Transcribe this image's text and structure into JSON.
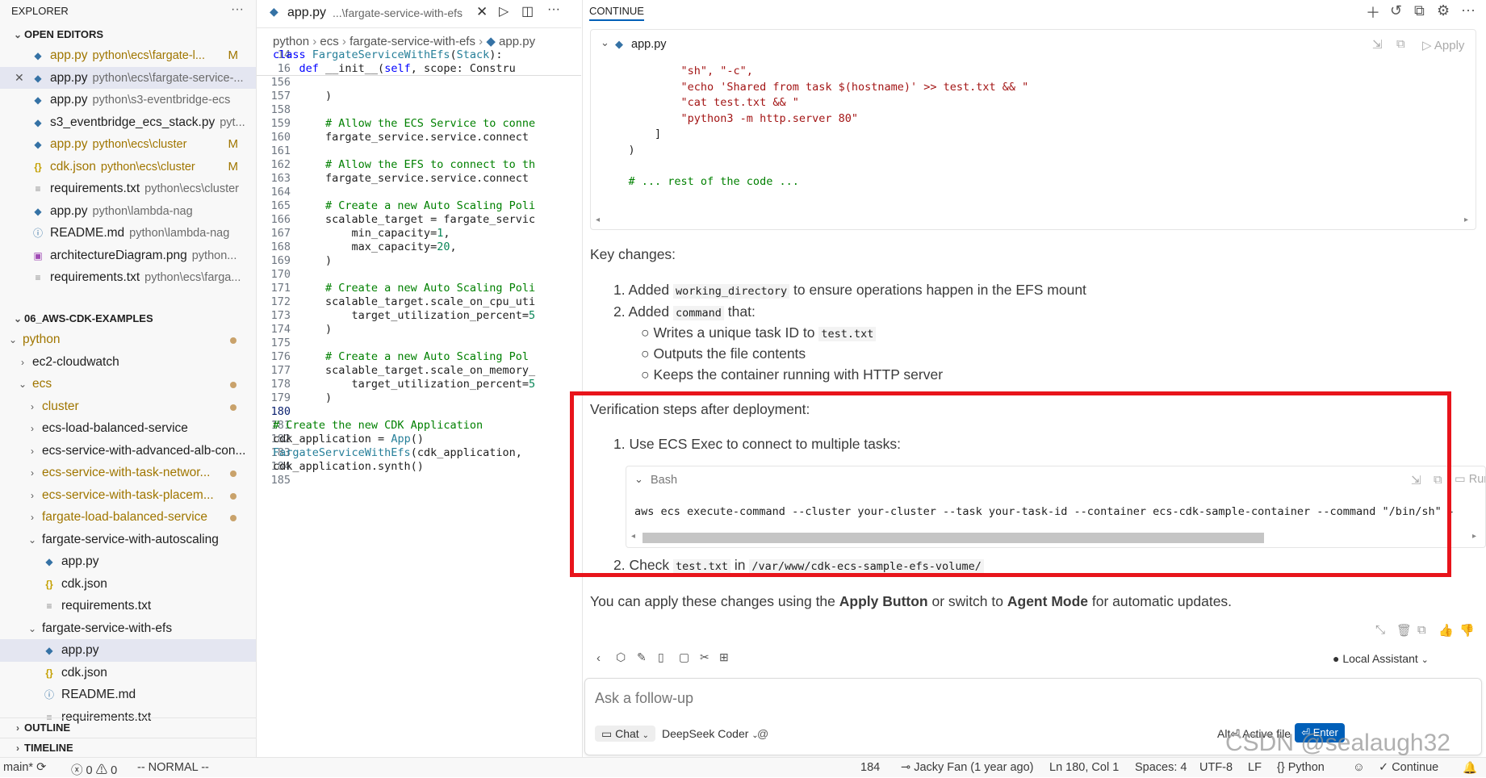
{
  "explorer": {
    "title": "EXPLORER",
    "more": "···",
    "open_editors_header": "OPEN EDITORS",
    "open_editors": [
      {
        "name": "app.py",
        "path": "python\\ecs\\fargate-l...",
        "badge": "M",
        "icon": "python-icon",
        "modified": true
      },
      {
        "name": "app.py",
        "path": "python\\ecs\\fargate-service-...",
        "badge": "",
        "icon": "python-icon",
        "modified": false
      },
      {
        "name": "app.py",
        "path": "python\\s3-eventbridge-ecs",
        "badge": "",
        "icon": "python-icon",
        "modified": false
      },
      {
        "name": "s3_eventbridge_ecs_stack.py",
        "path": "pyt...",
        "badge": "",
        "icon": "python-icon",
        "modified": false
      },
      {
        "name": "app.py",
        "path": "python\\ecs\\cluster",
        "badge": "M",
        "icon": "python-icon",
        "modified": true
      },
      {
        "name": "cdk.json",
        "path": "python\\ecs\\cluster",
        "badge": "M",
        "icon": "json-icon",
        "modified": true
      },
      {
        "name": "requirements.txt",
        "path": "python\\ecs\\cluster",
        "badge": "",
        "icon": "text-file-icon",
        "modified": false
      },
      {
        "name": "app.py",
        "path": "python\\lambda-nag",
        "badge": "",
        "icon": "python-icon",
        "modified": false
      },
      {
        "name": "README.md",
        "path": "python\\lambda-nag",
        "badge": "",
        "icon": "info-icon",
        "modified": false
      },
      {
        "name": "architectureDiagram.png",
        "path": "python...",
        "badge": "",
        "icon": "image-icon",
        "modified": false
      },
      {
        "name": "requirements.txt",
        "path": "python\\ecs\\farga...",
        "badge": "",
        "icon": "text-file-icon",
        "modified": false
      }
    ],
    "workspace_header": "06_AWS-CDK-EXAMPLES",
    "tree": [
      {
        "label": "python",
        "indent": 0,
        "chev": "open",
        "dot": true,
        "mod": true
      },
      {
        "label": "ec2-cloudwatch",
        "indent": 1,
        "chev": "closed",
        "dot": false,
        "mod": false
      },
      {
        "label": "ecs",
        "indent": 1,
        "chev": "open",
        "dot": true,
        "mod": true
      },
      {
        "label": "cluster",
        "indent": 2,
        "chev": "closed",
        "dot": true,
        "mod": true
      },
      {
        "label": "ecs-load-balanced-service",
        "indent": 2,
        "chev": "closed",
        "dot": false,
        "mod": false
      },
      {
        "label": "ecs-service-with-advanced-alb-con...",
        "indent": 2,
        "chev": "closed",
        "dot": false,
        "mod": false
      },
      {
        "label": "ecs-service-with-task-networ...",
        "indent": 2,
        "chev": "closed",
        "dot": true,
        "mod": true
      },
      {
        "label": "ecs-service-with-task-placem...",
        "indent": 2,
        "chev": "closed",
        "dot": true,
        "mod": true
      },
      {
        "label": "fargate-load-balanced-service",
        "indent": 2,
        "chev": "closed",
        "dot": true,
        "mod": true
      },
      {
        "label": "fargate-service-with-autoscaling",
        "indent": 2,
        "chev": "open",
        "dot": false,
        "mod": false
      },
      {
        "label": "app.py",
        "indent": 3,
        "icon": "python-icon",
        "dot": false,
        "mod": false
      },
      {
        "label": "cdk.json",
        "indent": 3,
        "icon": "json-icon",
        "dot": false,
        "mod": false
      },
      {
        "label": "requirements.txt",
        "indent": 3,
        "icon": "text-file-icon",
        "dot": false,
        "mod": false
      },
      {
        "label": "fargate-service-with-efs",
        "indent": 2,
        "chev": "open",
        "dot": false,
        "mod": false
      },
      {
        "label": "app.py",
        "indent": 3,
        "icon": "python-icon",
        "dot": false,
        "mod": false,
        "selected": true
      },
      {
        "label": "cdk.json",
        "indent": 3,
        "icon": "json-icon",
        "dot": false,
        "mod": false
      },
      {
        "label": "README.md",
        "indent": 3,
        "icon": "info-icon",
        "dot": false,
        "mod": false
      },
      {
        "label": "requirements.txt",
        "indent": 3,
        "icon": "text-file-icon",
        "dot": false,
        "mod": false
      }
    ],
    "outline": "OUTLINE",
    "timeline": "TIMELINE"
  },
  "editor": {
    "tab_name": "app.py",
    "tab_path": "...\\fargate-service-with-efs",
    "breadcrumb": [
      "python",
      "ecs",
      "fargate-service-with-efs",
      "app.py"
    ],
    "sticky": [
      {
        "n": "14",
        "t": "class FargateServiceWithEfs(Stack):"
      },
      {
        "n": "16",
        "t": "    def __init__(self, scope: Constru"
      }
    ],
    "lines": [
      {
        "n": "156",
        "t": ""
      },
      {
        "n": "157",
        "t": "        )"
      },
      {
        "n": "158",
        "t": ""
      },
      {
        "n": "159",
        "t": "        # Allow the ECS Service to conne"
      },
      {
        "n": "160",
        "t": "        fargate_service.service.connect"
      },
      {
        "n": "161",
        "t": ""
      },
      {
        "n": "162",
        "t": "        # Allow the EFS to connect to th"
      },
      {
        "n": "163",
        "t": "        fargate_service.service.connect"
      },
      {
        "n": "164",
        "t": ""
      },
      {
        "n": "165",
        "t": "        # Create a new Auto Scaling Poli"
      },
      {
        "n": "166",
        "t": "        scalable_target = fargate_servic"
      },
      {
        "n": "167",
        "t": "            min_capacity=1,"
      },
      {
        "n": "168",
        "t": "            max_capacity=20,"
      },
      {
        "n": "169",
        "t": "        )"
      },
      {
        "n": "170",
        "t": ""
      },
      {
        "n": "171",
        "t": "        # Create a new Auto Scaling Poli"
      },
      {
        "n": "172",
        "t": "        scalable_target.scale_on_cpu_uti"
      },
      {
        "n": "173",
        "t": "            target_utilization_percent=5"
      },
      {
        "n": "174",
        "t": "        )"
      },
      {
        "n": "175",
        "t": ""
      },
      {
        "n": "176",
        "t": "        # Create a new Auto Scaling Pol"
      },
      {
        "n": "177",
        "t": "        scalable_target.scale_on_memory_"
      },
      {
        "n": "178",
        "t": "            target_utilization_percent=5"
      },
      {
        "n": "179",
        "t": "        )"
      },
      {
        "n": "180",
        "t": ""
      },
      {
        "n": "181",
        "t": "# Create the new CDK Application"
      },
      {
        "n": "182",
        "t": "cdk_application = App()"
      },
      {
        "n": "183",
        "t": "FargateServiceWithEfs(cdk_application,"
      },
      {
        "n": "184",
        "t": "cdk_application.synth()"
      },
      {
        "n": "185",
        "t": ""
      }
    ]
  },
  "continue": {
    "tab": "CONTINUE",
    "code_block": {
      "filename": "app.py",
      "apply": "Apply",
      "lines": [
        "            \"sh\", \"-c\",",
        "            \"echo 'Shared from task $(hostname)' >> test.txt && \"",
        "            \"cat test.txt && \"",
        "            \"python3 -m http.server 80\"",
        "        ]",
        "    )",
        "",
        "    # ... rest of the code ..."
      ]
    },
    "key_changes": "Key changes:",
    "item1_prefix": "Added",
    "item1_code": "working_directory",
    "item1_suffix": "to ensure operations happen in the EFS mount",
    "item2_prefix": "Added",
    "item2_code": "command",
    "item2_suffix": "that:",
    "sub1_prefix": "Writes a unique task ID to",
    "sub1_code": "test.txt",
    "sub2": "Outputs the file contents",
    "sub3": "Keeps the container running with HTTP server",
    "verification": "Verification steps after deployment:",
    "step1": "Use ECS Exec to connect to multiple tasks:",
    "bash_label": "Bash",
    "bash_run": "Run",
    "bash_cmd": "aws ecs execute-command --cluster your-cluster --task your-task-id --container ecs-cdk-sample-container --command \"/bin/sh\" -",
    "step2_prefix": "Check",
    "step2_code1": "test.txt",
    "step2_mid": "in",
    "step2_code2": "/var/www/cdk-ecs-sample-efs-volume/",
    "apply_note_1": "You can apply these changes using the",
    "apply_note_b1": "Apply Button",
    "apply_note_2": "or switch to",
    "apply_note_b2": "Agent Mode",
    "apply_note_3": "for automatic updates.",
    "assistant": "Local Assistant",
    "followup_placeholder": "Ask a follow-up",
    "mode": "Chat",
    "model": "DeepSeek Coder",
    "at": "@",
    "active_file": "Alt⏎ Active file",
    "enter": "⏎ Enter"
  },
  "status": {
    "branch": "main*",
    "errors": "0",
    "warnings": "0",
    "vim_mode": "-- NORMAL --",
    "col_count": "184",
    "blame": "Jacky Fan (1 year ago)",
    "position": "Ln 180, Col 1",
    "spaces": "Spaces: 4",
    "encoding": "UTF-8",
    "eol": "LF",
    "language": "Python",
    "continue": "Continue"
  },
  "watermark": "CSDN @sealaugh32",
  "colors": {
    "highlight_box": "#e8141b",
    "accent": "#005fb8",
    "selection": "#e4e6f1"
  }
}
